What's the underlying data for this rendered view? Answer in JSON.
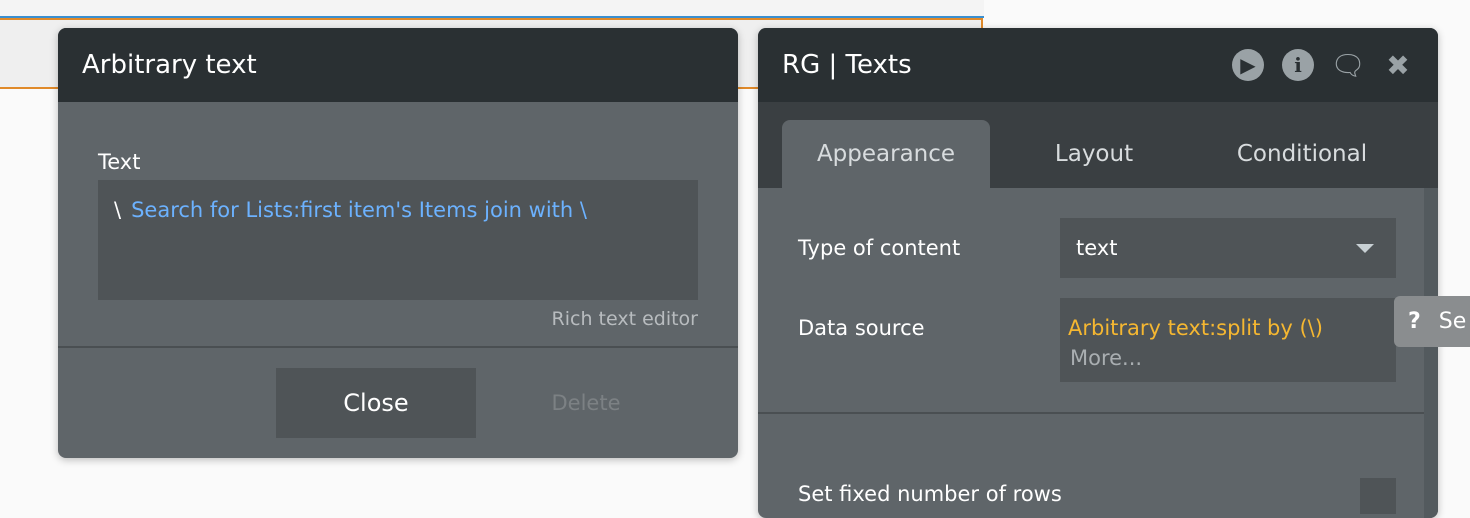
{
  "arbitrary_panel": {
    "title": "Arbitrary text",
    "text_label": "Text",
    "text_prefix": "\\",
    "text_dynamic": "Search for Lists:first item's Items join with \\",
    "rich_text_editor": "Rich text editor",
    "close": "Close",
    "delete": "Delete"
  },
  "rg_panel": {
    "title": "RG | Texts",
    "tabs": [
      "Appearance",
      "Layout",
      "Conditional"
    ],
    "type_label": "Type of content",
    "type_value": "text",
    "source_label": "Data source",
    "source_value": "Arbitrary text:split by (\\)",
    "source_more": "More...",
    "fixed_rows_label": "Set fixed number of rows"
  },
  "tooltip": {
    "icon": "?",
    "text": "Se"
  }
}
